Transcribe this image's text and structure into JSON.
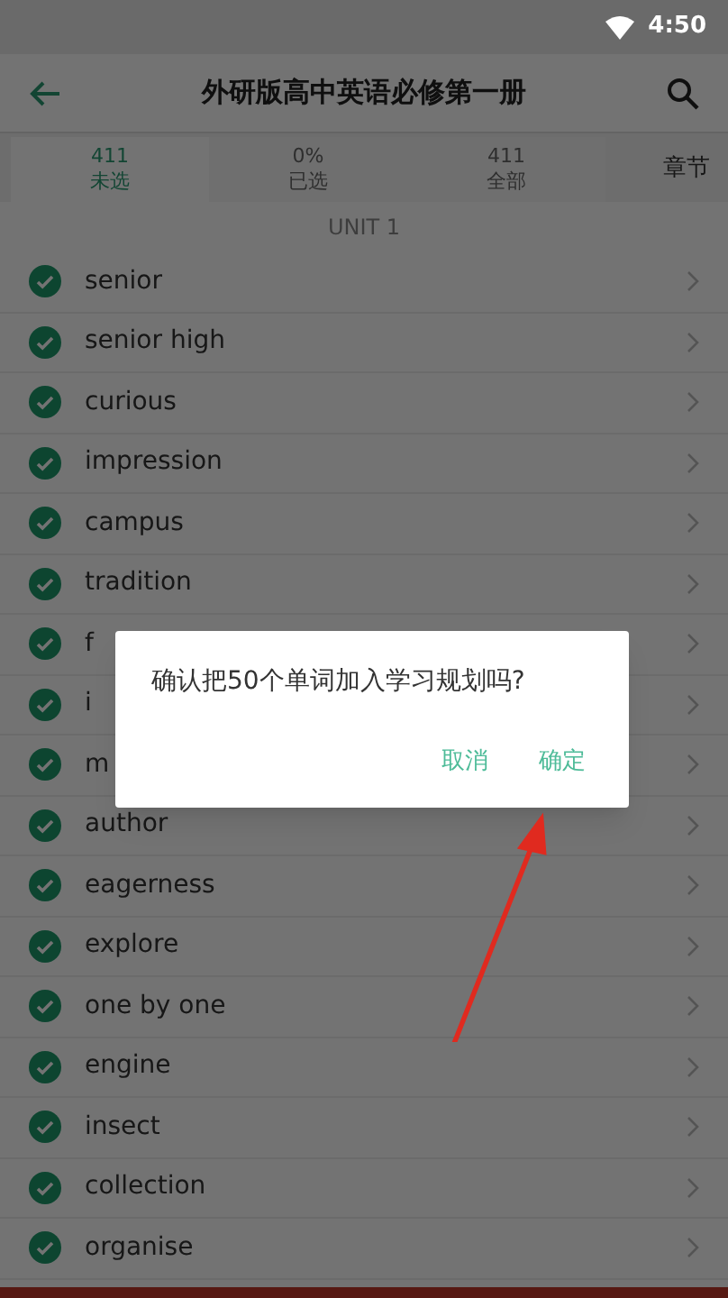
{
  "status_bar": {
    "time": "4:50"
  },
  "app_bar": {
    "title": "外研版高中英语必修第一册"
  },
  "tabs": [
    {
      "count": "411",
      "label": "未选",
      "selected": true
    },
    {
      "count": "0%",
      "label": "已选",
      "selected": false
    },
    {
      "count": "411",
      "label": "全部",
      "selected": false
    }
  ],
  "chapter_button": "章节",
  "unit_header": "UNIT 1",
  "words": [
    {
      "word": "senior",
      "checked": true
    },
    {
      "word": "senior high",
      "checked": true
    },
    {
      "word": "curious",
      "checked": true
    },
    {
      "word": "impression",
      "checked": true
    },
    {
      "word": "campus",
      "checked": true
    },
    {
      "word": "tradition",
      "checked": true
    },
    {
      "word": "f",
      "checked": true
    },
    {
      "word": "i",
      "checked": true
    },
    {
      "word": "m",
      "checked": true
    },
    {
      "word": "author",
      "checked": true
    },
    {
      "word": "eagerness",
      "checked": true
    },
    {
      "word": "explore",
      "checked": true
    },
    {
      "word": "one by one",
      "checked": true
    },
    {
      "word": "engine",
      "checked": true
    },
    {
      "word": "insect",
      "checked": true
    },
    {
      "word": "collection",
      "checked": true
    },
    {
      "word": "organise",
      "checked": true
    }
  ],
  "dialog": {
    "message": "确认把50个单词加入学习规划吗?",
    "buttons": [
      "取消",
      "确定"
    ]
  }
}
